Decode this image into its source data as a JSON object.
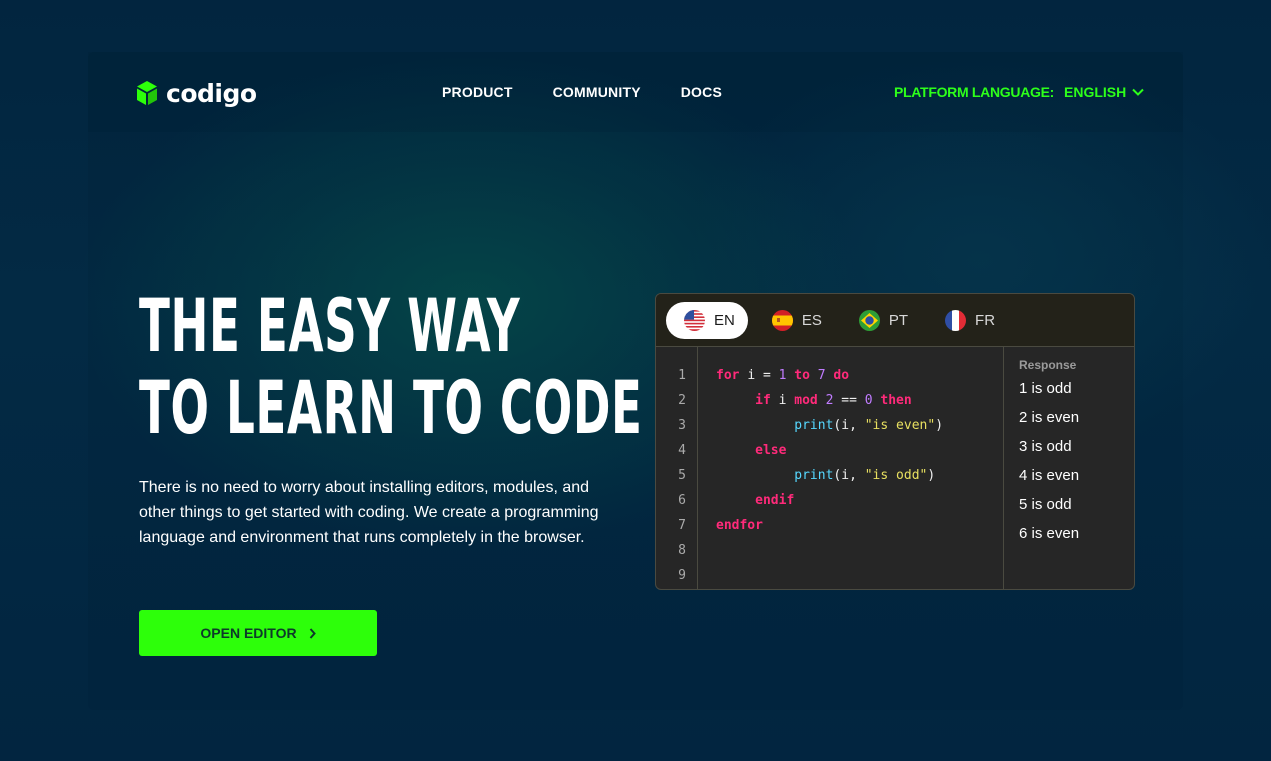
{
  "brand": {
    "name": "codigo"
  },
  "nav": {
    "items": [
      "PRODUCT",
      "COMMUNITY",
      "DOCS"
    ]
  },
  "language_selector": {
    "label": "PLATFORM LANGUAGE:",
    "value": "ENGLISH"
  },
  "hero": {
    "title_lines": [
      "THE EASY WAY",
      "TO LEARN TO CODE"
    ],
    "description": "There is no need to worry about installing editors, modules, and other things to get started with coding. We create a programming language and environment that runs completely in the browser.",
    "cta_label": "OPEN EDITOR"
  },
  "editor": {
    "tabs": [
      {
        "code": "EN",
        "active": true
      },
      {
        "code": "ES",
        "active": false
      },
      {
        "code": "PT",
        "active": false
      },
      {
        "code": "FR",
        "active": false
      }
    ],
    "line_numbers": [
      "1",
      "2",
      "3",
      "4",
      "5",
      "6",
      "7",
      "8",
      "9"
    ],
    "code_lines": [
      "for i = 1 to 7 do",
      "     if i mod 2 == 0 then",
      "          print(i, \"is even\")",
      "     else",
      "          print(i, \"is odd\")",
      "     endif",
      "endfor",
      "",
      ""
    ],
    "response": {
      "title": "Response",
      "lines": [
        "1 is odd",
        "2 is even",
        "3 is odd",
        "4 is even",
        "5 is odd",
        "6 is even"
      ]
    }
  },
  "colors": {
    "accent": "#2dff0a",
    "background": "#02233f",
    "keyword": "#ff2a7a",
    "number": "#c07cff",
    "function": "#56d8ff",
    "string": "#e8e060"
  },
  "icons": {
    "logo": "cube-icon",
    "dropdown": "chevron-down-icon",
    "cta": "chevron-right-icon",
    "flags": [
      "us-flag-icon",
      "spain-flag-icon",
      "brazil-flag-icon",
      "france-flag-icon"
    ]
  }
}
